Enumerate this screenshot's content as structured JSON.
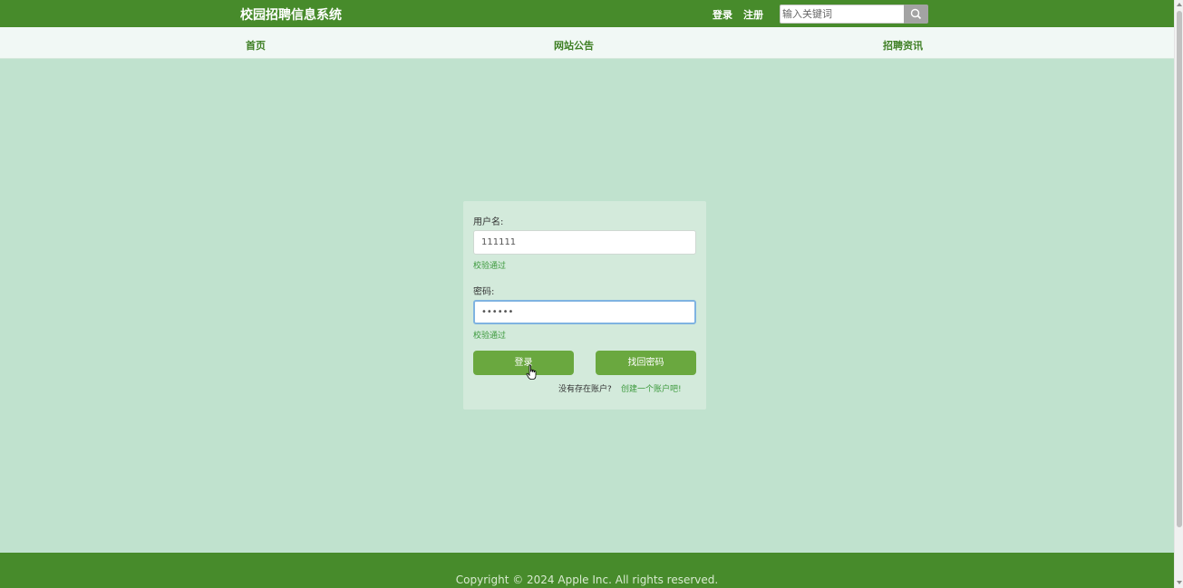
{
  "header": {
    "site_title": "校园招聘信息系统",
    "login_link": "登录",
    "register_link": "注册",
    "search_placeholder": "输入关键词",
    "search_icon": "search-icon"
  },
  "nav": {
    "items": [
      {
        "label": "首页"
      },
      {
        "label": "网站公告"
      },
      {
        "label": "招聘资讯"
      }
    ]
  },
  "login_form": {
    "username_label": "用户名:",
    "username_value": "111111",
    "username_valid": "校验通过",
    "password_label": "密码:",
    "password_value": "••••••",
    "password_valid": "校验通过",
    "login_button": "登录",
    "forgot_button": "找回密码",
    "no_account_text": "没有存在账户?",
    "create_account_link": "创建一个账户吧!"
  },
  "footer": {
    "copyright": "Copyright © 2024 Apple Inc. All rights reserved."
  },
  "colors": {
    "header_green": "#478b2b",
    "button_green": "#6aa83f",
    "page_bg": "#c0e2ce",
    "panel_bg": "#d3eadb",
    "nav_text": "#3e7f24"
  }
}
